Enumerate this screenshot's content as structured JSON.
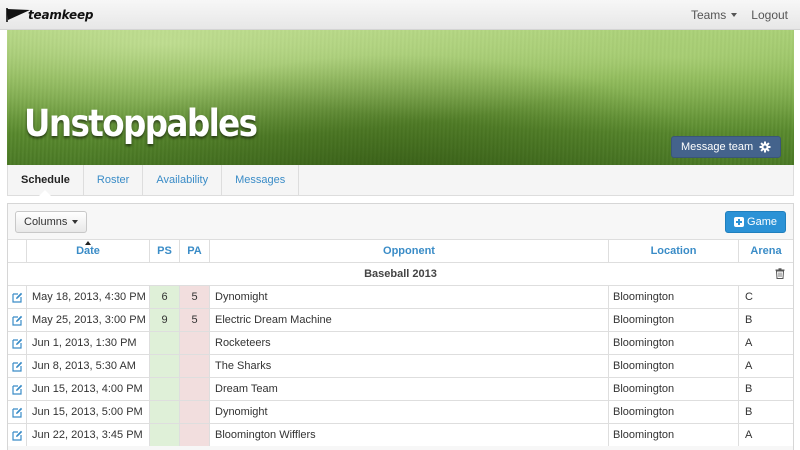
{
  "navbar": {
    "logo_text": "teamkeep",
    "teams_label": "Teams",
    "logout_label": "Logout"
  },
  "hero": {
    "team_name": "Unstoppables",
    "message_button": "Message team"
  },
  "tabs": [
    {
      "label": "Schedule",
      "active": true
    },
    {
      "label": "Roster",
      "active": false
    },
    {
      "label": "Availability",
      "active": false
    },
    {
      "label": "Messages",
      "active": false
    }
  ],
  "toolbar": {
    "columns_label": "Columns",
    "add_game_label": "Game"
  },
  "table": {
    "headers": {
      "date": "Date",
      "ps": "PS",
      "pa": "PA",
      "opponent": "Opponent",
      "location": "Location",
      "arena": "Arena"
    },
    "group_label": "Baseball 2013",
    "rows": [
      {
        "date": "May 18, 2013, 4:30 PM",
        "ps": "6",
        "pa": "5",
        "opponent": "Dynomight",
        "location": "Bloomington",
        "arena": "C"
      },
      {
        "date": "May 25, 2013, 3:00 PM",
        "ps": "9",
        "pa": "5",
        "opponent": "Electric Dream Machine",
        "location": "Bloomington",
        "arena": "B"
      },
      {
        "date": "Jun 1, 2013, 1:30 PM",
        "ps": "",
        "pa": "",
        "opponent": "Rocketeers",
        "location": "Bloomington",
        "arena": "A"
      },
      {
        "date": "Jun 8, 2013, 5:30 AM",
        "ps": "",
        "pa": "",
        "opponent": "The Sharks",
        "location": "Bloomington",
        "arena": "A"
      },
      {
        "date": "Jun 15, 2013, 4:00 PM",
        "ps": "",
        "pa": "",
        "opponent": "Dream Team",
        "location": "Bloomington",
        "arena": "B"
      },
      {
        "date": "Jun 15, 2013, 5:00 PM",
        "ps": "",
        "pa": "",
        "opponent": "Dynomight",
        "location": "Bloomington",
        "arena": "B"
      },
      {
        "date": "Jun 22, 2013, 3:45 PM",
        "ps": "",
        "pa": "",
        "opponent": "Bloomington Wifflers",
        "location": "Bloomington",
        "arena": "A"
      }
    ]
  },
  "colors": {
    "accent": "#3a8cc7",
    "primary_button": "#2b92d6",
    "message_button": "#44638c",
    "ps_background": "#dff0d8",
    "pa_background": "#f2dede"
  }
}
